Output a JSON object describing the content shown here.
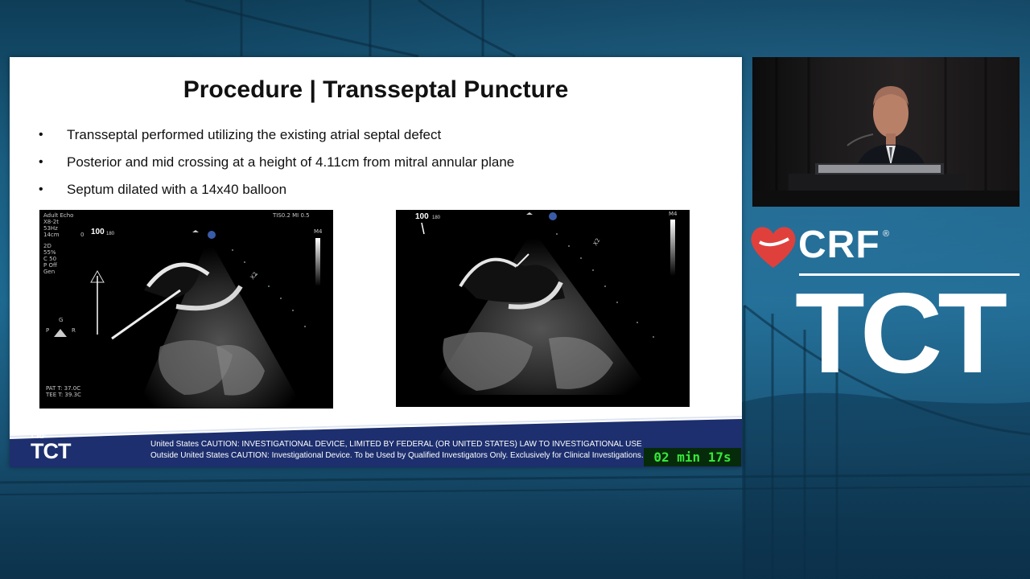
{
  "slide": {
    "title": "Procedure | Transseptal Puncture",
    "bullets": [
      "Transseptal performed utilizing the existing atrial septal defect",
      "Posterior and mid crossing at a height of 4.11cm from mitral annular plane",
      "Septum dilated with a 14x40 balloon"
    ],
    "bullet_symbol": "•",
    "echo_left": {
      "labels_left": [
        "Adult Echo",
        "X8-2t",
        "53Hz",
        "14cm",
        "",
        "2D",
        "55%",
        "C 50",
        "P Off",
        "Gen"
      ],
      "top_right": "TIS0.2   MI 0.5",
      "angle": "100",
      "angle_scale_left": "0",
      "angle_scale_right": "180",
      "marker": "M4",
      "footer": [
        "PAT T: 37.0C",
        "TEE T: 39.3C"
      ],
      "orientation_g": "G",
      "orientation_p": "P",
      "orientation_r": "R",
      "x2": "X2"
    },
    "echo_right": {
      "angle": "100",
      "angle_scale_right": "180",
      "marker": "M4",
      "x2": "X2"
    },
    "footer": {
      "line1": "United States CAUTION: INVESTIGATIONAL DEVICE, LIMITED BY FEDERAL (OR UNITED STATES) LAW TO INVESTIGATIONAL USE",
      "line2": "Outside United States CAUTION: Investigational Device. To be Used by Qualified Investigators Only. Exclusively for Clinical Investigations.",
      "logo_crf": "CRF",
      "logo_tct": "TCT"
    }
  },
  "timer": "02 min 17s",
  "brand": {
    "crf": "CRF",
    "registered": "®",
    "tct": "TCT"
  },
  "colors": {
    "background": "#1a5d80",
    "slide_footer_band": "#1d2f6e",
    "timer_text": "#35e83a",
    "brand_heart": "#e0403c"
  }
}
